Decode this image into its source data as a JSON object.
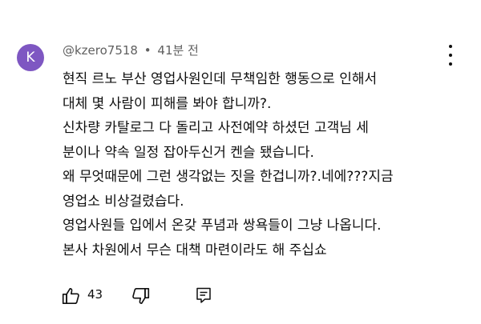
{
  "comment": {
    "avatar_letter": "K",
    "avatar_color": "#7e57c2",
    "author": "@kzero7518",
    "separator": "•",
    "time_ago": "41분 전",
    "lines": [
      "현직 르노 부산 영업사원인데 무책임한 행동으로 인해서",
      "대체 몇 사람이 피해를 봐야 합니까?.",
      "신차량 카탈로그 다 돌리고  사전예약 하셨던 고객님 세",
      "분이나 약속 일정 잡아두신거 켄슬 됐습니다.",
      "왜 무엇때문에 그런 생각없는 짓을 한겁니까?.네에???지금",
      "영업소 비상걸렸습다.",
      "영업사원들 입에서 온갖 푸념과 쌍욕들이 그냥 나옵니다.",
      "본사 차원에서 무슨 대책 마련이라도 해 주십쇼"
    ],
    "like_count": "43",
    "icons": {
      "like": "thumbs-up-icon",
      "dislike": "thumbs-down-icon",
      "reply": "reply-icon",
      "more": "more-vert-icon"
    }
  }
}
